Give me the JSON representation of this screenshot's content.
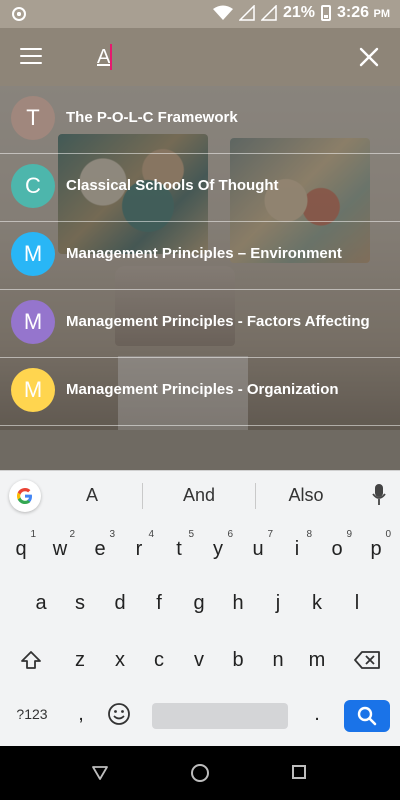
{
  "status_bar": {
    "battery": "21%",
    "time": "3:26",
    "ampm": "PM"
  },
  "search": {
    "query": "A"
  },
  "results": [
    {
      "initial": "T",
      "title": "The P-O-L-C Framework",
      "color": "#a0877d"
    },
    {
      "initial": "C",
      "title": "Classical Schools Of Thought",
      "color": "#4db6ac"
    },
    {
      "initial": "M",
      "title": "Management Principles – Environment",
      "color": "#29b6f6"
    },
    {
      "initial": "M",
      "title": "Management Principles - Factors Affecting",
      "color": "#9575cd"
    },
    {
      "initial": "M",
      "title": "Management Principles - Organization",
      "color": "#ffd54f"
    }
  ],
  "keyboard": {
    "suggestions": [
      "A",
      "And",
      "Also"
    ],
    "row1": [
      {
        "k": "q",
        "n": "1"
      },
      {
        "k": "w",
        "n": "2"
      },
      {
        "k": "e",
        "n": "3"
      },
      {
        "k": "r",
        "n": "4"
      },
      {
        "k": "t",
        "n": "5"
      },
      {
        "k": "y",
        "n": "6"
      },
      {
        "k": "u",
        "n": "7"
      },
      {
        "k": "i",
        "n": "8"
      },
      {
        "k": "o",
        "n": "9"
      },
      {
        "k": "p",
        "n": "0"
      }
    ],
    "row2": [
      "a",
      "s",
      "d",
      "f",
      "g",
      "h",
      "j",
      "k",
      "l"
    ],
    "row3": [
      "z",
      "x",
      "c",
      "v",
      "b",
      "n",
      "m"
    ],
    "symbols_label": "?123",
    "comma": ",",
    "period": ".",
    "accent_color": "#1a73e8"
  }
}
